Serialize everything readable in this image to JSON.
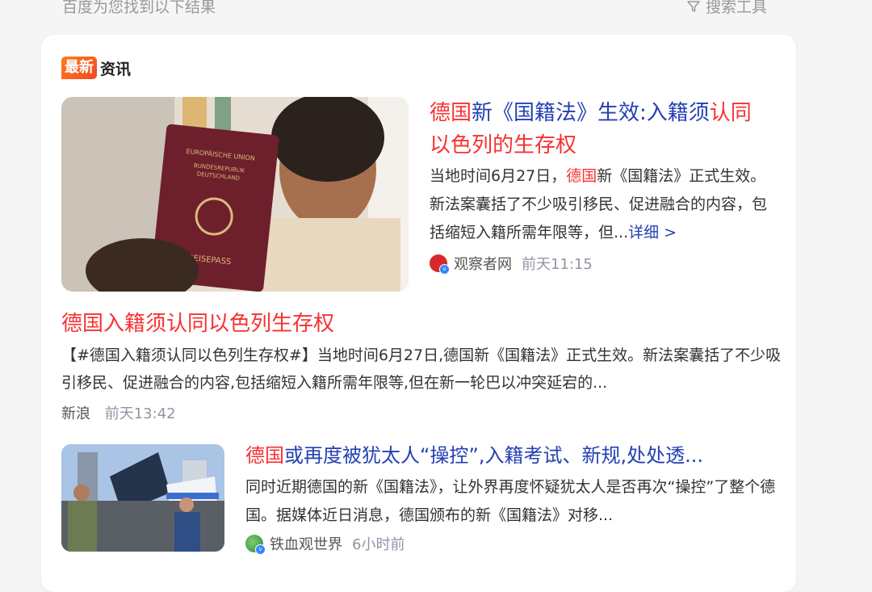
{
  "top": {
    "result_hint": "百度为您找到以下结果",
    "search_tools": "搜索工具",
    "search_tools_icon": "filter-icon"
  },
  "news_section": {
    "badge": "最新",
    "label": "资讯"
  },
  "items": [
    {
      "title_parts": [
        "德国",
        "新《国籍法》生效:入籍须",
        "认同以色列的生存权"
      ],
      "summary_pre": "当地时间6月27日，",
      "summary_hl": "德国",
      "summary_post": "新《国籍法》正式生效。新法案囊括了不少吸引移民、促进融合的内容，包括缩短入籍所需年限等，但...",
      "detail": "详细 >",
      "source": "观察者网",
      "time": "前天11:15"
    },
    {
      "title_parts": [
        "德国入籍须",
        "认同以色列生存权"
      ],
      "summary": "【#德国入籍须认同以色列生存权#】当地时间6月27日,德国新《国籍法》正式生效。新法案囊括了不少吸引移民、促进融合的内容,包括缩短入籍所需年限等,但在新一轮巴以冲突延宕的...",
      "source": "新浪",
      "time": "前天13:42"
    },
    {
      "title_parts": [
        "德国",
        "或再度被犹太人“操控”,入籍考试、新规,处处透..."
      ],
      "summary": "同时近期德国的新《国籍法》，让外界再度怀疑犹太人是否再次“操控”了整个德国。据媒体近日消息，德国颁布的新《国籍法》对移...",
      "source": "铁血观世界",
      "time": "6小时前"
    }
  ],
  "colors": {
    "highlight": "#f73131",
    "link": "#2440b3",
    "muted": "#9195a3"
  }
}
